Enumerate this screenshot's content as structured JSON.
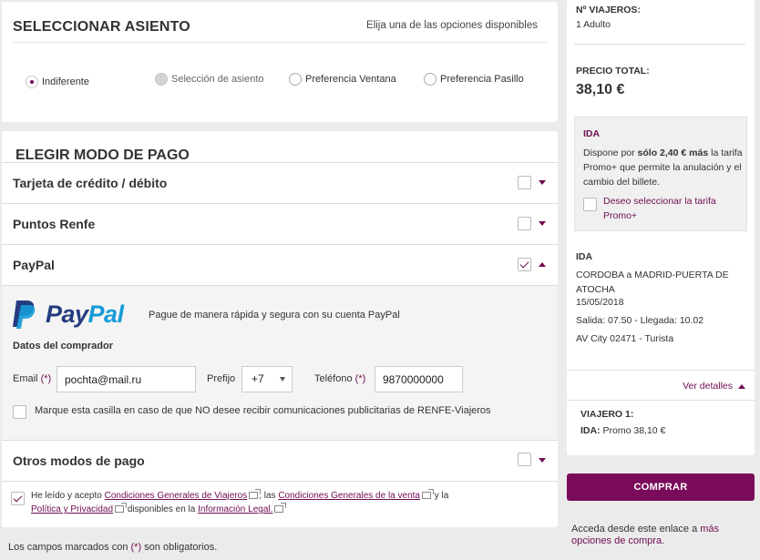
{
  "seat": {
    "title": "SELECCIONAR ASIENTO",
    "subtitle": "Elija una de las opciones disponibles",
    "options": [
      {
        "label": "Indiferente",
        "state": "selected"
      },
      {
        "label": "Selección de asiento",
        "state": "disabled"
      },
      {
        "label": "Preferencia Ventana",
        "state": "unselected"
      },
      {
        "label": "Preferencia Pasillo",
        "state": "unselected"
      }
    ]
  },
  "payment": {
    "title": "ELEGIR MODO DE PAGO",
    "methods": [
      {
        "label": "Tarjeta de crédito / débito",
        "checked": false,
        "expanded": false
      },
      {
        "label": "Puntos Renfe",
        "checked": false,
        "expanded": false
      },
      {
        "label": "PayPal",
        "checked": true,
        "expanded": true
      },
      {
        "label": "Otros modos de pago",
        "checked": false,
        "expanded": false
      }
    ],
    "paypal": {
      "logo_text_1": "Pay",
      "logo_text_2": "Pal",
      "description": "Pague de manera rápida y segura con su cuenta PayPal",
      "buyer_title": "Datos del comprador",
      "email_label": "Email",
      "email_value": "pochta@mail.ru",
      "prefix_label": "Prefijo",
      "prefix_value": "+7",
      "phone_label": "Teléfono",
      "phone_value": "9870000000",
      "required_mark": "(*)",
      "no_publicity": "Marque esta casilla en caso de que NO desee recibir comunicaciones publicitarias de RENFE-Viajeros"
    },
    "terms": {
      "t1": "He leído y acepto ",
      "l1": "Condiciones Generales de Viajeros",
      "t2": ", las ",
      "l2": "Condiciones Generales de la venta",
      "t3": " y la ",
      "l3": "Política y Privacidad",
      "t4": " disponibles en la ",
      "l4": "Información Legal."
    },
    "required_note_1": "Los campos marcados con ",
    "required_note_mark": "(*)",
    "required_note_2": " son obligatorios."
  },
  "summary": {
    "travelers_label": "Nº VIAJEROS:",
    "travelers_value": "1 Adulto",
    "total_label": "PRECIO TOTAL:",
    "total_value": "38,10 €",
    "promo": {
      "title": "IDA",
      "text_1": "Dispone por ",
      "text_bold": "sólo 2,40 € más",
      "text_2": " la tarifa Promo+ que permite la anulación y el cambio del billete.",
      "link": "Deseo seleccionar la tarifa Promo+"
    },
    "trip": {
      "label": "IDA",
      "route": "CORDOBA a MADRID-PUERTA DE ATOCHA",
      "date": "15/05/2018",
      "times": "Salida: 07.50 - Llegada: 10.02",
      "train": "AV City 02471 - Turista"
    },
    "details_link": "Ver detalles",
    "traveler_title": "VIAJERO 1:",
    "traveler_ida_label": "IDA:",
    "traveler_ida_value": " Promo 38,10 €",
    "buy_button": "COMPRAR",
    "more_text": "Acceda desde este enlace a ",
    "more_link": "más opciones de compra",
    "more_end": "."
  },
  "colors": {
    "brand": "#7a0b5a",
    "accent": "#6f0d52",
    "paypal_dark": "#253b80",
    "paypal_light": "#179bd7"
  }
}
